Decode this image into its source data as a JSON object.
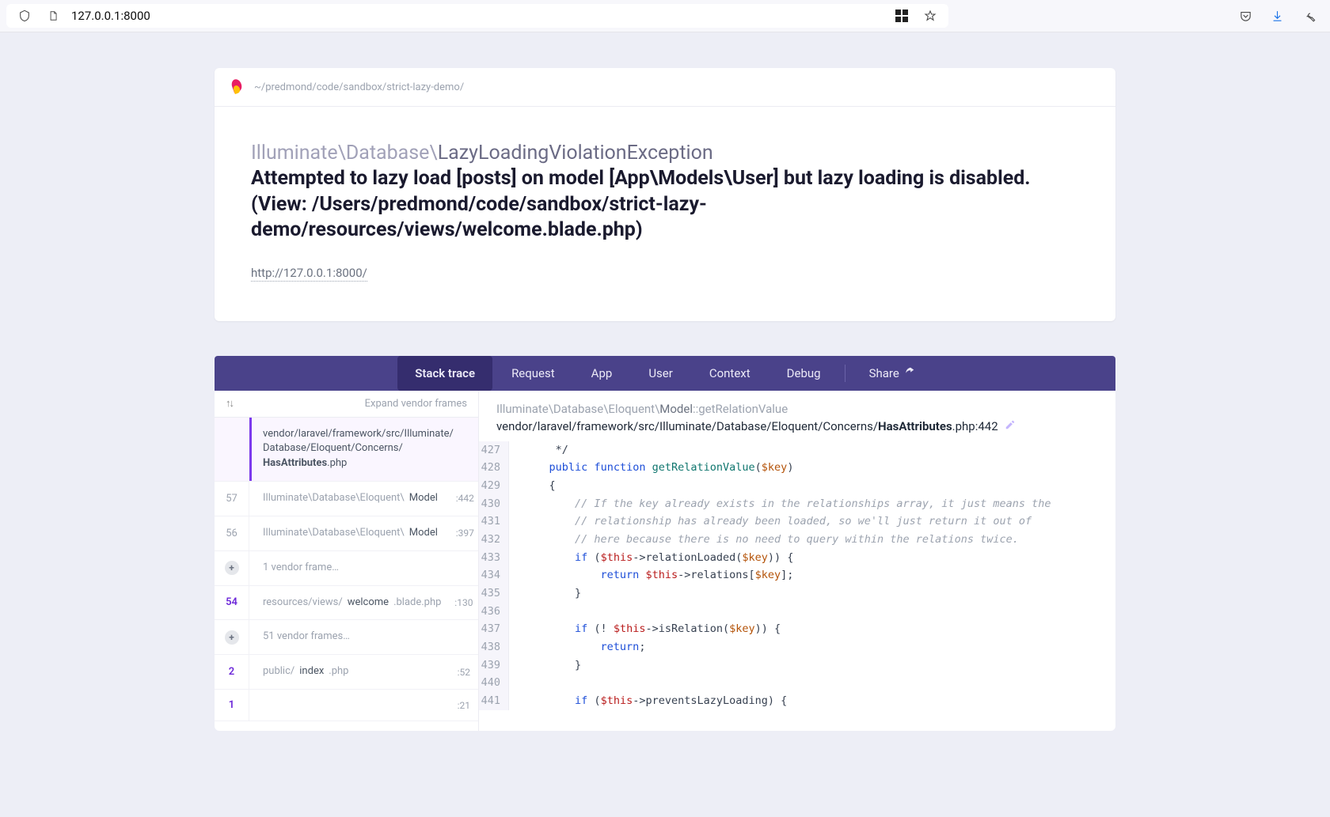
{
  "browser": {
    "url": "127.0.0.1:8000"
  },
  "header": {
    "project_path": "~/predmond/code/sandbox/strict-lazy-demo/",
    "exception_namespace": "Illuminate\\Database\\",
    "exception_class": "LazyLoadingViolationException",
    "exception_message": "Attempted to lazy load [posts] on model [App\\Models\\User] but lazy loading is disabled. (View: /Users/predmond/code/sandbox/strict-lazy-demo/resources/views/welcome.blade.php)",
    "request_url": "http://127.0.0.1:8000/"
  },
  "tabs": {
    "items": [
      "Stack trace",
      "Request",
      "App",
      "User",
      "Context",
      "Debug",
      "Share"
    ],
    "active_index": 0
  },
  "frames": {
    "expand_label": "Expand vendor frames",
    "rows": [
      {
        "num": "",
        "selected": true,
        "path_prefix": "vendor/laravel/framework/src/Illuminate/\nDatabase/Eloquent/Concerns/\n",
        "path_bold": "HasAttributes",
        "path_suffix": ".php",
        "line": ""
      },
      {
        "num": "57",
        "text_prefix": "Illuminate\\Database\\Eloquent\\",
        "text_strong": "Model",
        "line": ":442"
      },
      {
        "num": "56",
        "text_prefix": "Illuminate\\Database\\Eloquent\\",
        "text_strong": "Model",
        "line": ":397"
      },
      {
        "num": "",
        "collapsed": true,
        "text": "1 vendor frame…",
        "line": ""
      },
      {
        "num": "54",
        "hl": true,
        "text_prefix": "resources/views/",
        "text_strong": "welcome",
        "text_suffix": ".blade.php",
        "line": ":130"
      },
      {
        "num": "",
        "collapsed": true,
        "text": "51 vendor frames…",
        "line": ""
      },
      {
        "num": "2",
        "hl": true,
        "text_prefix": "public/",
        "text_strong": "index",
        "text_suffix": ".php",
        "line": ":52"
      },
      {
        "num": "1",
        "hl": true,
        "text_prefix": "",
        "text_strong": "",
        "text_suffix": "",
        "line": ":21"
      }
    ]
  },
  "code": {
    "namespace_prefix": "Illuminate\\Database\\Eloquent\\",
    "namespace_class": "Model",
    "namespace_method": "::getRelationValue",
    "file_prefix": "vendor/laravel/framework/src/Illuminate/Database/Eloquent/Concerns/",
    "file_bold": "HasAttributes",
    "file_suffix": ".php:442",
    "lines": [
      {
        "n": 427,
        "html": "     */"
      },
      {
        "n": 428,
        "html": "    <span class=\"tok-kw\">public</span> <span class=\"tok-kw\">function</span> <span class=\"tok-fn\">getRelationValue</span>(<span class=\"tok-var\">$key</span>)"
      },
      {
        "n": 429,
        "html": "    {"
      },
      {
        "n": 430,
        "html": "        <span class=\"tok-cmt\">// If the key already exists in the relationships array, it just means the</span>"
      },
      {
        "n": 431,
        "html": "        <span class=\"tok-cmt\">// relationship has already been loaded, so we'll just return it out of</span>"
      },
      {
        "n": 432,
        "html": "        <span class=\"tok-cmt\">// here because there is no need to query within the relations twice.</span>"
      },
      {
        "n": 433,
        "html": "        <span class=\"tok-kw\">if</span> (<span class=\"tok-this\">$this</span>-&gt;relationLoaded(<span class=\"tok-var\">$key</span>)) {"
      },
      {
        "n": 434,
        "html": "            <span class=\"tok-kw\">return</span> <span class=\"tok-this\">$this</span>-&gt;relations[<span class=\"tok-var\">$key</span>];"
      },
      {
        "n": 435,
        "html": "        }"
      },
      {
        "n": 436,
        "html": ""
      },
      {
        "n": 437,
        "html": "        <span class=\"tok-kw\">if</span> (! <span class=\"tok-this\">$this</span>-&gt;isRelation(<span class=\"tok-var\">$key</span>)) {"
      },
      {
        "n": 438,
        "html": "            <span class=\"tok-kw\">return</span>;"
      },
      {
        "n": 439,
        "html": "        }"
      },
      {
        "n": 440,
        "html": ""
      },
      {
        "n": 441,
        "html": "        <span class=\"tok-kw\">if</span> (<span class=\"tok-this\">$this</span>-&gt;preventsLazyLoading) {"
      }
    ]
  }
}
